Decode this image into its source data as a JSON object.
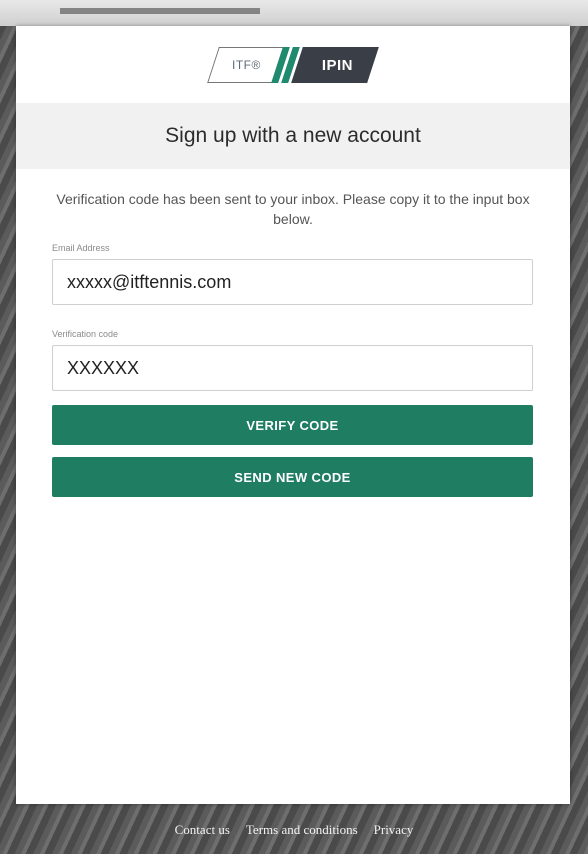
{
  "logo": {
    "left_text": "ITF®",
    "right_text": "IPIN",
    "accent_color": "#1f8a6e",
    "dark_color": "#3a3f47"
  },
  "heading": "Sign up with a new account",
  "info_text": "Verification code has been sent to your inbox. Please copy it to the input box below.",
  "email": {
    "label": "Email Address",
    "value": "xxxxx@itftennis.com"
  },
  "verification": {
    "label": "Verification code",
    "value": "XXXXXX"
  },
  "buttons": {
    "verify": "VERIFY CODE",
    "send_new": "SEND NEW CODE",
    "color": "#1f7d62"
  },
  "footer": {
    "contact": "Contact us",
    "terms": "Terms and conditions",
    "privacy": "Privacy"
  }
}
